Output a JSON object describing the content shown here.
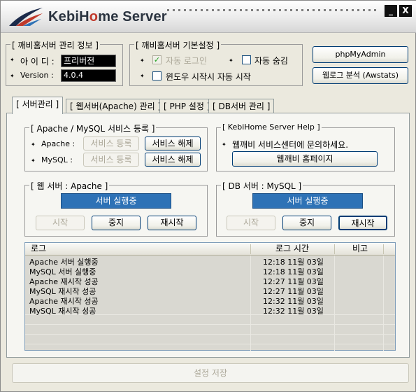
{
  "app": {
    "title_kebi": "KebiH",
    "title_o": "o",
    "title_rest": "me Server",
    "minimize_label": "_",
    "close_label": "X"
  },
  "info": {
    "title": "[ 깨비홈서버 관리 정보 ]",
    "id_label": "아 이 디 :",
    "id_value": "프리버전",
    "version_label": "Version :",
    "version_value": "4.0.4"
  },
  "basic": {
    "title": "[ 깨비홈서버 기본설정 ]",
    "auto_login_label": "자동 로그인",
    "auto_login_checked": true,
    "auto_hide_label": "자동 숨김",
    "auto_hide_checked": false,
    "win_start_label": "윈도우 시작시 자동 시작",
    "win_start_checked": false
  },
  "side_buttons": {
    "phpmyadmin": "phpMyAdmin",
    "weblog": "웹로그 분석 (Awstats)"
  },
  "tabs": [
    {
      "label": "[ 서버관리 ]",
      "active": true
    },
    {
      "label": "[ 웹서버(Apache) 관리 ]",
      "active": false
    },
    {
      "label": "[ PHP 설정 ]",
      "active": false
    },
    {
      "label": "[ DB서버 관리 ]",
      "active": false
    }
  ],
  "service": {
    "title": "[ Apache / MySQL 서비스 등록 ]",
    "apache_label": "Apache :",
    "mysql_label": "MySQL :",
    "register_label": "서비스 등록",
    "unregister_label": "서비스 해제"
  },
  "help": {
    "title": "[ KebiHome Server Help ]",
    "message": "웹깨비 서비스센터에 문의하세요.",
    "homepage_button": "웹깨비 홈페이지"
  },
  "web_server": {
    "title": "[ 웹 서버 : Apache ]",
    "status": "서버 실행중",
    "start": "시작",
    "stop": "중지",
    "restart": "재시작"
  },
  "db_server": {
    "title": "[ DB 서버 : MySQL ]",
    "status": "서버 실행중",
    "start": "시작",
    "stop": "중지",
    "restart": "재시작"
  },
  "log": {
    "headers": [
      "로그",
      "로그 시간",
      "비고"
    ],
    "rows": [
      {
        "message": "Apache 서버 실행중",
        "time": "12:18  11월 03일",
        "note": ""
      },
      {
        "message": "MySQL 서버 실행중",
        "time": "12:18  11월 03일",
        "note": ""
      },
      {
        "message": "Apache 재시작 성공",
        "time": "12:27  11월 03일",
        "note": ""
      },
      {
        "message": "MySQL 재시작 성공",
        "time": "12:27  11월 03일",
        "note": ""
      },
      {
        "message": "Apache 재시작 성공",
        "time": "12:32  11월 03일",
        "note": ""
      },
      {
        "message": "MySQL 재시작 성공",
        "time": "12:32  11월 03일",
        "note": ""
      }
    ]
  },
  "save_label": "설정 저장",
  "colors": {
    "status_bg": "#2e72b6",
    "window_bg": "#ebe9de",
    "brand_red": "#c0392b"
  }
}
